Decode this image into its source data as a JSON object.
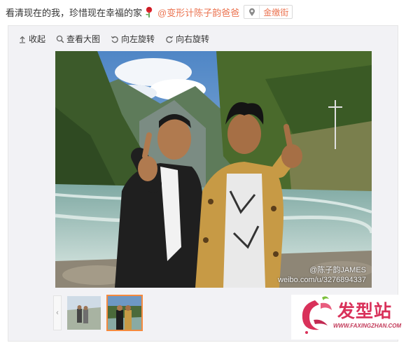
{
  "post": {
    "text": "看清现在的我，珍惜现在幸福的家",
    "mention": "@变形计陈子韵爸爸",
    "location": "金缴街"
  },
  "toolbar": {
    "collapse_label": "收起",
    "view_large_label": "查看大图",
    "rotate_left_label": "向左旋转",
    "rotate_right_label": "向右旋转"
  },
  "photo": {
    "watermark_handle": "@陈子韵JAMES",
    "watermark_url": "weibo.com/u/3276894337"
  },
  "thumbnails": {
    "count": 2,
    "active_index": 1
  },
  "logo": {
    "brand": "发型站",
    "url": "WWW.FAXINGZHAN.COM"
  },
  "colors": {
    "accent": "#eb7350",
    "panel_bg": "#f2f2f5",
    "active_border": "#f58a3f",
    "logo_brand": "#d9315a"
  },
  "icons": [
    "rose-emoji-icon",
    "location-pin-icon",
    "collapse-arrow-icon",
    "magnifier-icon",
    "rotate-left-icon",
    "rotate-right-icon",
    "chevron-left-icon"
  ]
}
